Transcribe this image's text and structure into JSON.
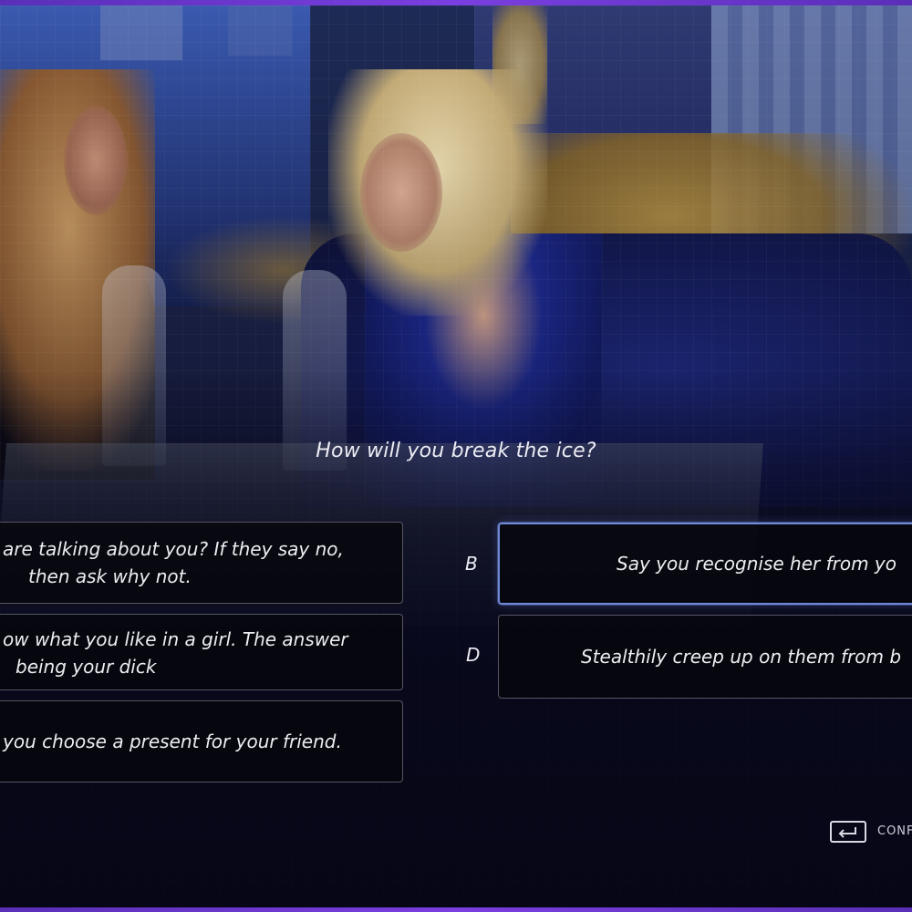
{
  "question": "How will you break the ice?",
  "choices": [
    {
      "id": "A",
      "letter": "",
      "lines": [
        "are talking about you? If they say no,",
        "then ask why not."
      ]
    },
    {
      "id": "B",
      "letter": "B",
      "lines": [
        "Say you recognise her from yo"
      ],
      "selected": true
    },
    {
      "id": "C",
      "letter": "",
      "lines": [
        "ow what you like in a girl. The answer",
        "being your dick"
      ]
    },
    {
      "id": "D",
      "letter": "D",
      "lines": [
        "Stealthily creep up on them from b"
      ]
    },
    {
      "id": "E",
      "letter": "",
      "lines": [
        "you choose a present for your friend."
      ]
    }
  ],
  "confirm": {
    "label": "CONF",
    "icon": "enter-key-icon"
  },
  "colors": {
    "frame": "#6a36d0",
    "selected_border": "#6f88d8",
    "panel": "#06060c"
  }
}
